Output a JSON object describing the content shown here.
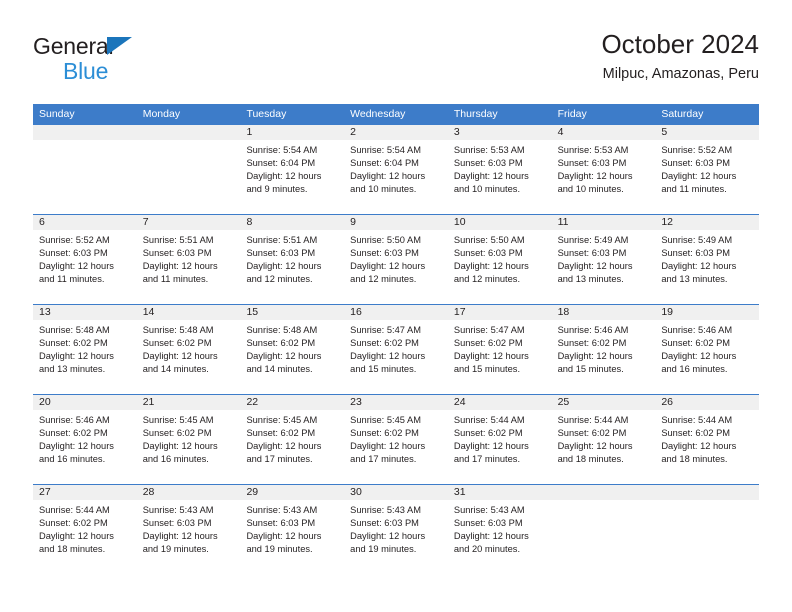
{
  "brand": {
    "line1": "General",
    "line2": "Blue",
    "triangle_color": "#1b75bb"
  },
  "header": {
    "title": "October 2024",
    "subtitle": "Milpuc, Amazonas, Peru"
  },
  "theme": {
    "header_blue": "#3d7cc9",
    "day_number_bg": "#f0f0f0",
    "text": "#231f20"
  },
  "weekdays": [
    "Sunday",
    "Monday",
    "Tuesday",
    "Wednesday",
    "Thursday",
    "Friday",
    "Saturday"
  ],
  "weeks": [
    [
      {
        "day": "",
        "sunrise": "",
        "sunset": "",
        "daylight": "",
        "empty": true
      },
      {
        "day": "",
        "sunrise": "",
        "sunset": "",
        "daylight": "",
        "empty": true
      },
      {
        "day": "1",
        "sunrise": "Sunrise: 5:54 AM",
        "sunset": "Sunset: 6:04 PM",
        "daylight": "Daylight: 12 hours and 9 minutes."
      },
      {
        "day": "2",
        "sunrise": "Sunrise: 5:54 AM",
        "sunset": "Sunset: 6:04 PM",
        "daylight": "Daylight: 12 hours and 10 minutes."
      },
      {
        "day": "3",
        "sunrise": "Sunrise: 5:53 AM",
        "sunset": "Sunset: 6:03 PM",
        "daylight": "Daylight: 12 hours and 10 minutes."
      },
      {
        "day": "4",
        "sunrise": "Sunrise: 5:53 AM",
        "sunset": "Sunset: 6:03 PM",
        "daylight": "Daylight: 12 hours and 10 minutes."
      },
      {
        "day": "5",
        "sunrise": "Sunrise: 5:52 AM",
        "sunset": "Sunset: 6:03 PM",
        "daylight": "Daylight: 12 hours and 11 minutes."
      }
    ],
    [
      {
        "day": "6",
        "sunrise": "Sunrise: 5:52 AM",
        "sunset": "Sunset: 6:03 PM",
        "daylight": "Daylight: 12 hours and 11 minutes."
      },
      {
        "day": "7",
        "sunrise": "Sunrise: 5:51 AM",
        "sunset": "Sunset: 6:03 PM",
        "daylight": "Daylight: 12 hours and 11 minutes."
      },
      {
        "day": "8",
        "sunrise": "Sunrise: 5:51 AM",
        "sunset": "Sunset: 6:03 PM",
        "daylight": "Daylight: 12 hours and 12 minutes."
      },
      {
        "day": "9",
        "sunrise": "Sunrise: 5:50 AM",
        "sunset": "Sunset: 6:03 PM",
        "daylight": "Daylight: 12 hours and 12 minutes."
      },
      {
        "day": "10",
        "sunrise": "Sunrise: 5:50 AM",
        "sunset": "Sunset: 6:03 PM",
        "daylight": "Daylight: 12 hours and 12 minutes."
      },
      {
        "day": "11",
        "sunrise": "Sunrise: 5:49 AM",
        "sunset": "Sunset: 6:03 PM",
        "daylight": "Daylight: 12 hours and 13 minutes."
      },
      {
        "day": "12",
        "sunrise": "Sunrise: 5:49 AM",
        "sunset": "Sunset: 6:03 PM",
        "daylight": "Daylight: 12 hours and 13 minutes."
      }
    ],
    [
      {
        "day": "13",
        "sunrise": "Sunrise: 5:48 AM",
        "sunset": "Sunset: 6:02 PM",
        "daylight": "Daylight: 12 hours and 13 minutes."
      },
      {
        "day": "14",
        "sunrise": "Sunrise: 5:48 AM",
        "sunset": "Sunset: 6:02 PM",
        "daylight": "Daylight: 12 hours and 14 minutes."
      },
      {
        "day": "15",
        "sunrise": "Sunrise: 5:48 AM",
        "sunset": "Sunset: 6:02 PM",
        "daylight": "Daylight: 12 hours and 14 minutes."
      },
      {
        "day": "16",
        "sunrise": "Sunrise: 5:47 AM",
        "sunset": "Sunset: 6:02 PM",
        "daylight": "Daylight: 12 hours and 15 minutes."
      },
      {
        "day": "17",
        "sunrise": "Sunrise: 5:47 AM",
        "sunset": "Sunset: 6:02 PM",
        "daylight": "Daylight: 12 hours and 15 minutes."
      },
      {
        "day": "18",
        "sunrise": "Sunrise: 5:46 AM",
        "sunset": "Sunset: 6:02 PM",
        "daylight": "Daylight: 12 hours and 15 minutes."
      },
      {
        "day": "19",
        "sunrise": "Sunrise: 5:46 AM",
        "sunset": "Sunset: 6:02 PM",
        "daylight": "Daylight: 12 hours and 16 minutes."
      }
    ],
    [
      {
        "day": "20",
        "sunrise": "Sunrise: 5:46 AM",
        "sunset": "Sunset: 6:02 PM",
        "daylight": "Daylight: 12 hours and 16 minutes."
      },
      {
        "day": "21",
        "sunrise": "Sunrise: 5:45 AM",
        "sunset": "Sunset: 6:02 PM",
        "daylight": "Daylight: 12 hours and 16 minutes."
      },
      {
        "day": "22",
        "sunrise": "Sunrise: 5:45 AM",
        "sunset": "Sunset: 6:02 PM",
        "daylight": "Daylight: 12 hours and 17 minutes."
      },
      {
        "day": "23",
        "sunrise": "Sunrise: 5:45 AM",
        "sunset": "Sunset: 6:02 PM",
        "daylight": "Daylight: 12 hours and 17 minutes."
      },
      {
        "day": "24",
        "sunrise": "Sunrise: 5:44 AM",
        "sunset": "Sunset: 6:02 PM",
        "daylight": "Daylight: 12 hours and 17 minutes."
      },
      {
        "day": "25",
        "sunrise": "Sunrise: 5:44 AM",
        "sunset": "Sunset: 6:02 PM",
        "daylight": "Daylight: 12 hours and 18 minutes."
      },
      {
        "day": "26",
        "sunrise": "Sunrise: 5:44 AM",
        "sunset": "Sunset: 6:02 PM",
        "daylight": "Daylight: 12 hours and 18 minutes."
      }
    ],
    [
      {
        "day": "27",
        "sunrise": "Sunrise: 5:44 AM",
        "sunset": "Sunset: 6:02 PM",
        "daylight": "Daylight: 12 hours and 18 minutes."
      },
      {
        "day": "28",
        "sunrise": "Sunrise: 5:43 AM",
        "sunset": "Sunset: 6:03 PM",
        "daylight": "Daylight: 12 hours and 19 minutes."
      },
      {
        "day": "29",
        "sunrise": "Sunrise: 5:43 AM",
        "sunset": "Sunset: 6:03 PM",
        "daylight": "Daylight: 12 hours and 19 minutes."
      },
      {
        "day": "30",
        "sunrise": "Sunrise: 5:43 AM",
        "sunset": "Sunset: 6:03 PM",
        "daylight": "Daylight: 12 hours and 19 minutes."
      },
      {
        "day": "31",
        "sunrise": "Sunrise: 5:43 AM",
        "sunset": "Sunset: 6:03 PM",
        "daylight": "Daylight: 12 hours and 20 minutes."
      },
      {
        "day": "",
        "sunrise": "",
        "sunset": "",
        "daylight": "",
        "empty": true
      },
      {
        "day": "",
        "sunrise": "",
        "sunset": "",
        "daylight": "",
        "empty": true
      }
    ]
  ]
}
